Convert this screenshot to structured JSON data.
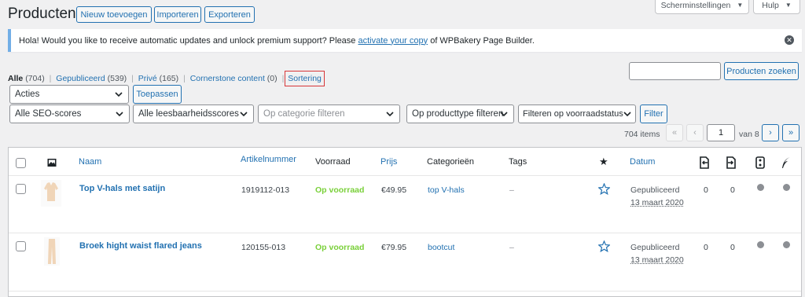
{
  "header": {
    "title": "Producten",
    "buttons": [
      "Nieuw toevoegen",
      "Importeren",
      "Exporteren"
    ],
    "screen_options": "Scherminstellingen",
    "help": "Hulp"
  },
  "notice": {
    "text_before": "Hola! Would you like to receive automatic updates and unlock premium support? Please ",
    "link": "activate your copy",
    "text_after": " of WPBakery Page Builder."
  },
  "views": [
    {
      "label": "Alle",
      "count": "(704)"
    },
    {
      "label": "Gepubliceerd",
      "count": "(539)"
    },
    {
      "label": "Privé",
      "count": "(165)"
    },
    {
      "label": "Cornerstone content",
      "count": "(0)"
    },
    {
      "label": "Sortering",
      "count": ""
    }
  ],
  "search": {
    "value": "",
    "button": "Producten zoeken"
  },
  "bulk": {
    "selected": "Acties",
    "apply": "Toepassen"
  },
  "filters": {
    "seo": "Alle SEO-scores",
    "readability": "Alle leesbaarheidsscores",
    "category_placeholder": "Op categorie filteren",
    "product_type": "Op producttype filteren",
    "stock": "Filteren op voorraadstatus",
    "button": "Filter"
  },
  "pagination": {
    "count": "704 items",
    "first": "«",
    "prev": "‹",
    "current": "1",
    "of": "van 8",
    "next": "›",
    "last": "»"
  },
  "table": {
    "headers": {
      "name": "Naam",
      "sku": "Artikelnummer",
      "stock": "Voorraad",
      "price": "Prijs",
      "categories": "Categorieën",
      "tags": "Tags",
      "date": "Datum"
    },
    "rows": [
      {
        "name": "Top V-hals met satijn",
        "sku": "1919112-013",
        "stock": "Op voorraad",
        "price": "€49.95",
        "category": "top V-hals",
        "tags": "–",
        "status": "Gepubliceerd",
        "date": "13 maart 2020",
        "col1": "0",
        "col2": "0"
      },
      {
        "name": "Broek hight waist flared jeans",
        "sku": "120155-013",
        "stock": "Op voorraad",
        "price": "€79.95",
        "category": "bootcut",
        "tags": "–",
        "status": "Gepubliceerd",
        "date": "13 maart 2020",
        "col1": "0",
        "col2": "0"
      }
    ]
  },
  "colors": {
    "accent": "#2271b1",
    "in_stock": "#7ad03a",
    "highlight": "#d63638",
    "notice_border": "#72aee6"
  }
}
